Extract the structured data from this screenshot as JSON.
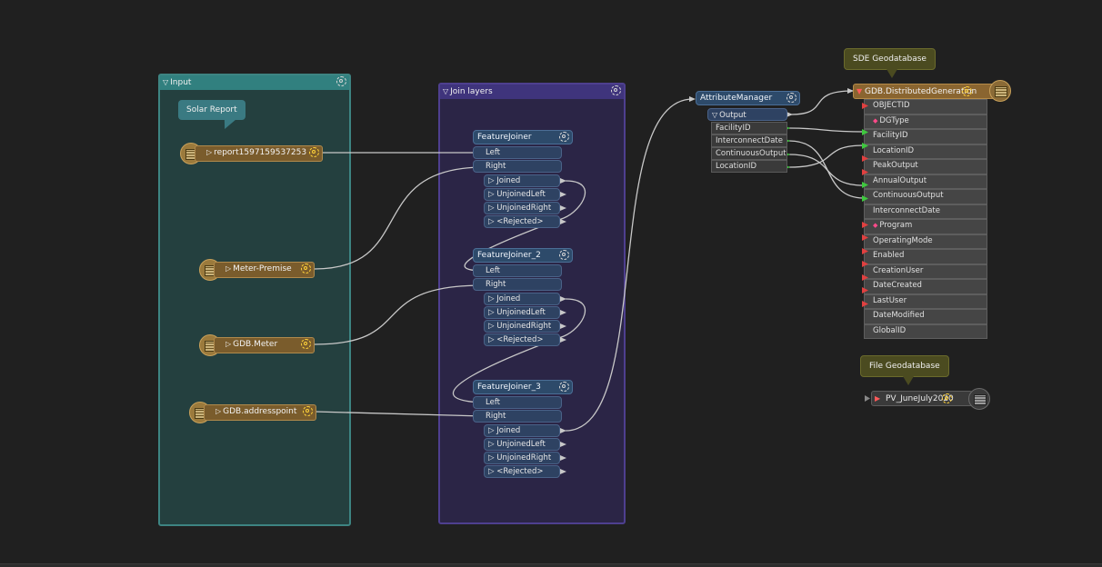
{
  "bookmarks": {
    "input": {
      "title": "Input",
      "color": "#31807f"
    },
    "join": {
      "title": "Join layers",
      "color": "#3f347c"
    }
  },
  "annotations": {
    "solar": "Solar Report",
    "sde": "SDE Geodatabase",
    "file_gdb": "File Geodatabase"
  },
  "readers": [
    {
      "label": "report1597159537253"
    },
    {
      "label": "Meter-Premise"
    },
    {
      "label": "GDB.Meter"
    },
    {
      "label": "GDB.addresspoint"
    }
  ],
  "joiners": [
    {
      "title": "FeatureJoiner"
    },
    {
      "title": "FeatureJoiner_2"
    },
    {
      "title": "FeatureJoiner_3"
    }
  ],
  "ports": {
    "inputs": [
      "Left",
      "Right"
    ],
    "outputs": [
      "Joined",
      "UnjoinedLeft",
      "UnjoinedRight",
      "<Rejected>"
    ]
  },
  "attribute_manager": {
    "title": "AttributeManager",
    "output": "Output",
    "attributes": [
      "FacilityID",
      "InterconnectDate",
      "ContinuousOutput",
      "LocationID"
    ]
  },
  "writer": {
    "title": "GDB.DistributedGeneration",
    "attributes": [
      "OBJECTID",
      "DGType",
      "FacilityID",
      "LocationID",
      "PeakOutput",
      "AnnualOutput",
      "ContinuousOutput",
      "InterconnectDate",
      "Program",
      "OperatingMode",
      "Enabled",
      "CreationUser",
      "DateCreated",
      "LastUser",
      "DateModified",
      "GlobalID"
    ]
  },
  "file_writer": {
    "title": "PV_JuneJuly2020"
  },
  "colors": {
    "background": "#202020",
    "connection": "#c8c8c8",
    "port_green": "#3ec83e",
    "port_red": "#e14040"
  }
}
